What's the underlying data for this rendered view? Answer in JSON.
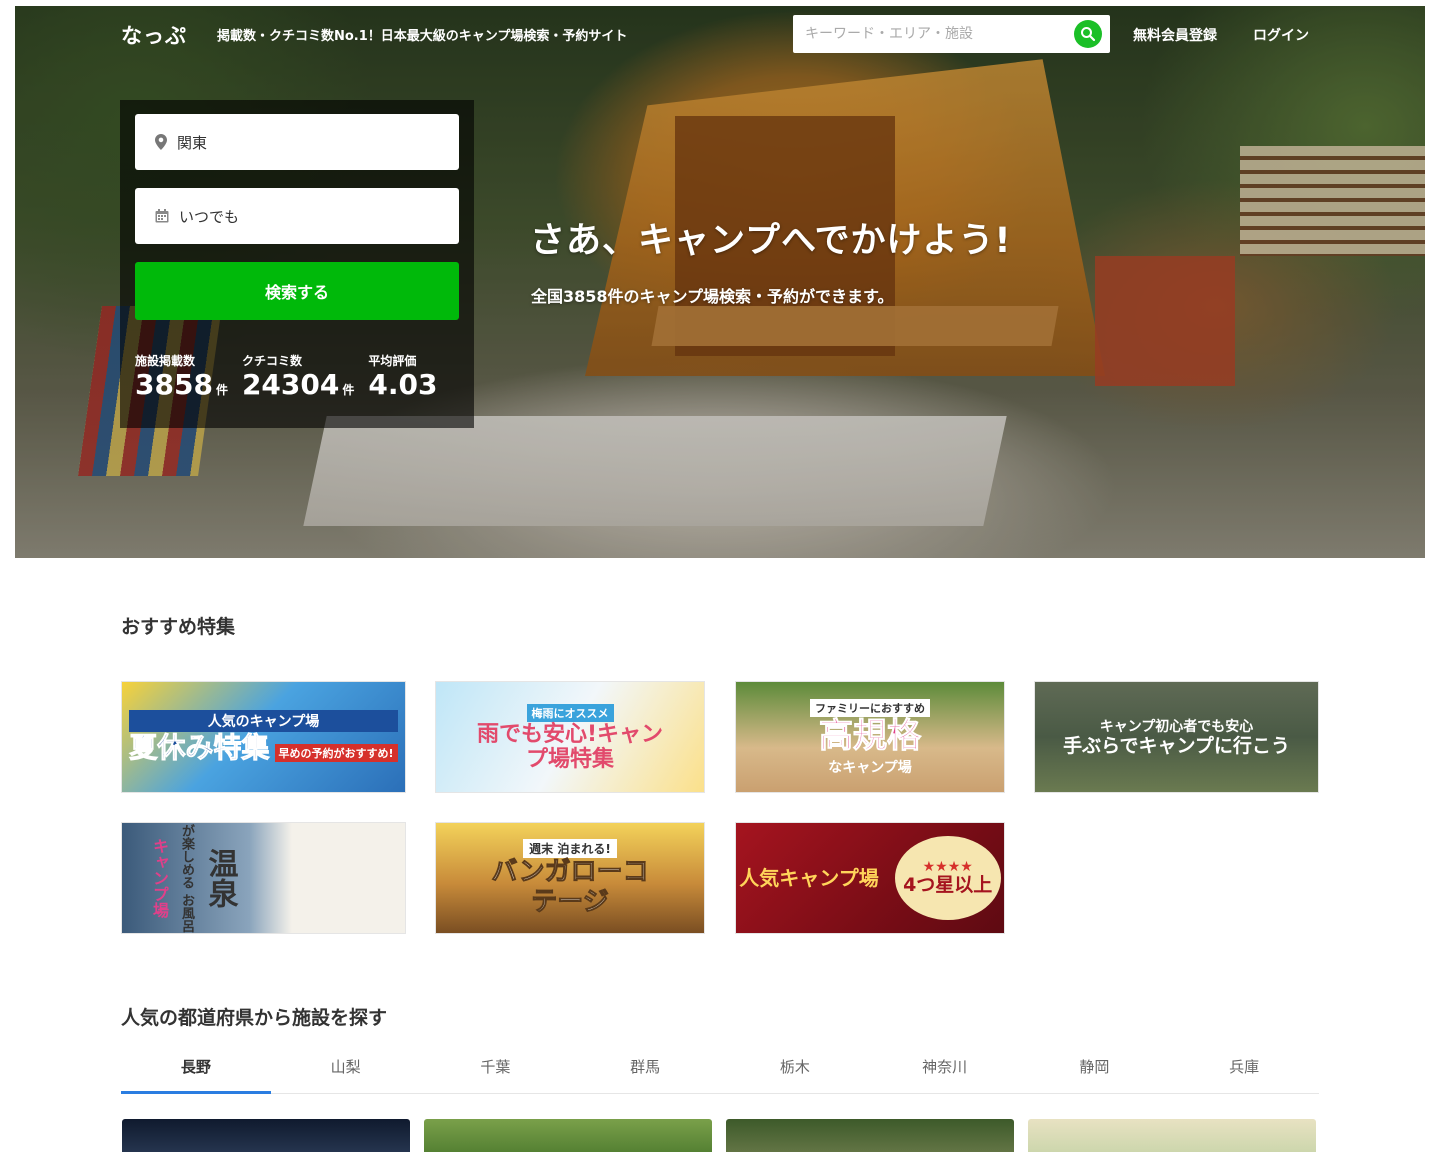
{
  "header": {
    "logo": "なっぷ",
    "tagline": "掲載数・クチコミ数No.1！日本最大級のキャンプ場検索・予約サイト",
    "search_placeholder": "キーワード・エリア・施設",
    "register": "無料会員登録",
    "login": "ログイン"
  },
  "search_panel": {
    "area": "関東",
    "date": "いつでも",
    "submit": "検索する",
    "stats": [
      {
        "label": "施設掲載数",
        "value": "3858",
        "unit": "件"
      },
      {
        "label": "クチコミ数",
        "value": "24304",
        "unit": "件"
      },
      {
        "label": "平均評価",
        "value": "4.03",
        "unit": ""
      }
    ]
  },
  "hero": {
    "title": "さあ、キャンプへでかけよう!",
    "subtitle": "全国3858件のキャンプ場検索・予約ができます。"
  },
  "features": {
    "title": "おすすめ特集",
    "banners": [
      {
        "sub": "人気のキャンプ場",
        "main": "夏休み特集",
        "extra": "早めの予約がおすすめ!"
      },
      {
        "sub": "梅雨にオススメ",
        "main": "雨でも安心!キャンプ場特集",
        "extra": ""
      },
      {
        "sub": "ファミリーにおすすめ",
        "main": "高規格",
        "extra": "なキャンプ場"
      },
      {
        "sub": "キャンプ初心者でも安心",
        "main": "手ぶらでキャンプに行こう",
        "extra": ""
      },
      {
        "sub": "キャンプ場",
        "main": "温泉",
        "extra": "が楽しめる お風呂"
      },
      {
        "sub": "週末 泊まれる!",
        "main": "バンガローコテージ",
        "extra": ""
      },
      {
        "sub": "人気キャンプ場",
        "main": "4つ星以上",
        "extra": "★★★★"
      }
    ]
  },
  "prefectures": {
    "title": "人気の都道府県から施設を探す",
    "tabs": [
      "長野",
      "山梨",
      "千葉",
      "群馬",
      "栃木",
      "神奈川",
      "静岡",
      "兵庫"
    ],
    "active": "長野"
  },
  "colors": {
    "green": "#00b90a",
    "tab_accent": "#2a7de1"
  }
}
